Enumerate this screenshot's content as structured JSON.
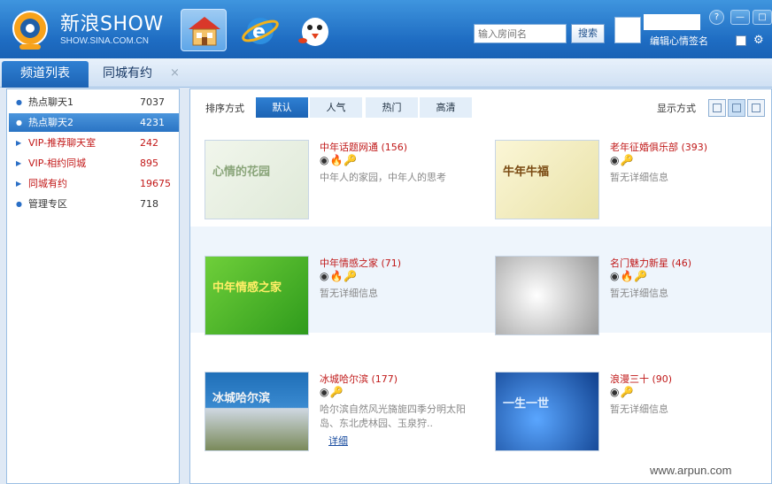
{
  "header": {
    "brand": "新浪SHOW",
    "brand_sub": "SHOW.SINA.COM.CN",
    "search_placeholder": "输入房间名",
    "search_button": "搜索",
    "signature": "编辑心情签名",
    "help": "?",
    "min": "—",
    "max": "□",
    "nav_icons": [
      "home-icon",
      "ie-icon",
      "qq-penguin-icon"
    ]
  },
  "tabs": [
    {
      "label": "频道列表",
      "active": true
    },
    {
      "label": "同城有约",
      "active": false,
      "close": "×"
    }
  ],
  "sidebar": [
    {
      "label": "热点聊天1",
      "count": "7037",
      "style": "blue"
    },
    {
      "label": "热点聊天2",
      "count": "4231",
      "style": "sel"
    },
    {
      "label": "VIP-推荐聊天室",
      "count": "242",
      "style": "red"
    },
    {
      "label": "VIP-相约同城",
      "count": "895",
      "style": "red"
    },
    {
      "label": "同城有约",
      "count": "19675",
      "style": "red"
    },
    {
      "label": "管理专区",
      "count": "718",
      "style": "blue"
    }
  ],
  "sort": {
    "label": "排序方式",
    "options": [
      "默认",
      "人气",
      "热门",
      "高清"
    ],
    "display_label": "显示方式"
  },
  "rooms": [
    {
      "title": "中年话题网通",
      "count": "(156)",
      "icons": "◉🔥🔑",
      "desc": "中年人的家园，中年人的思考",
      "thumb_text": "心情的花园"
    },
    {
      "title": "老年征婚俱乐部",
      "count": "(393)",
      "icons": "◉🔑",
      "desc": "暂无详细信息",
      "thumb_text": "牛年牛福"
    },
    {
      "title": "中年情感之家",
      "count": "(71)",
      "icons": "◉🔥🔑",
      "desc": "暂无详细信息",
      "thumb_text": "中年情感之家"
    },
    {
      "title": "名门魅力新星",
      "count": "(46)",
      "icons": "◉🔥🔑",
      "desc": "暂无详细信息",
      "thumb_text": ""
    },
    {
      "title": "冰城哈尔滨",
      "count": "(177)",
      "icons": "◉🔑",
      "desc": "哈尔滨自然风光旖旎四季分明太阳岛、东北虎林园、玉泉狩..",
      "more": "详细",
      "thumb_text": "冰城哈尔滨"
    },
    {
      "title": "浪漫三十",
      "count": "(90)",
      "icons": "◉🔑",
      "desc": "暂无详细信息",
      "thumb_text": "一生一世"
    }
  ],
  "watermark": "www.arpun.com"
}
